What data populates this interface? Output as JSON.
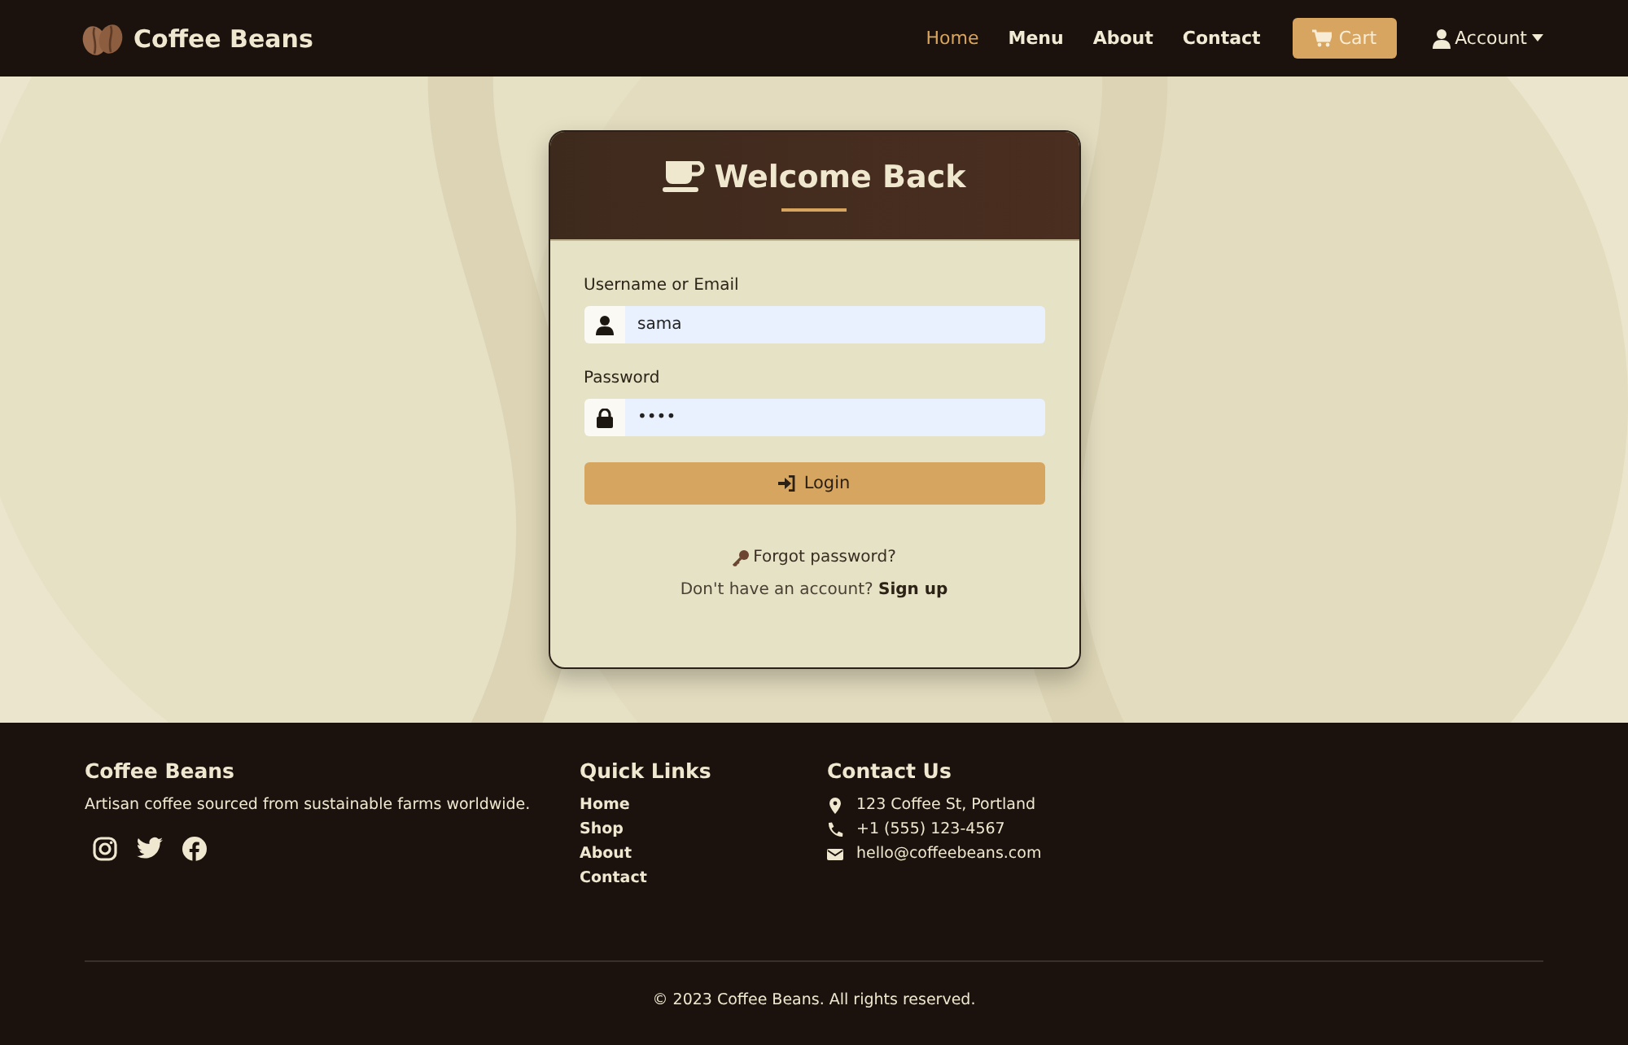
{
  "navbar": {
    "brand": "Coffee Beans",
    "links": [
      {
        "label": "Home",
        "selected": true
      },
      {
        "label": "Menu",
        "selected": false
      },
      {
        "label": "About",
        "selected": false
      },
      {
        "label": "Contact",
        "selected": false
      }
    ],
    "cart": "Cart",
    "account": "Account"
  },
  "login": {
    "title": "Welcome Back",
    "fields": [
      {
        "label": "Username or Email",
        "value": "sama",
        "kind": "user"
      },
      {
        "label": "Password",
        "value": "••••",
        "kind": "lock"
      }
    ],
    "submit": "Login",
    "forgot": "Forgot password?",
    "signup_prompt": "Don't have an account?",
    "signup_link": "Sign up"
  },
  "footer": {
    "brand": "Coffee Beans",
    "tagline": "Artisan coffee sourced from sustainable farms worldwide.",
    "quick_links_title": "Quick Links",
    "quick_links": [
      "Home",
      "Shop",
      "About",
      "Contact"
    ],
    "contact_title": "Contact Us",
    "contacts": [
      {
        "kind": "address",
        "text": "123 Coffee St, Portland"
      },
      {
        "kind": "phone",
        "text": "+1 (555) 123-4567"
      },
      {
        "kind": "email",
        "text": "hello@coffeebeans.com"
      }
    ],
    "copyright": "© 2023 Coffee Beans. All rights reserved."
  }
}
